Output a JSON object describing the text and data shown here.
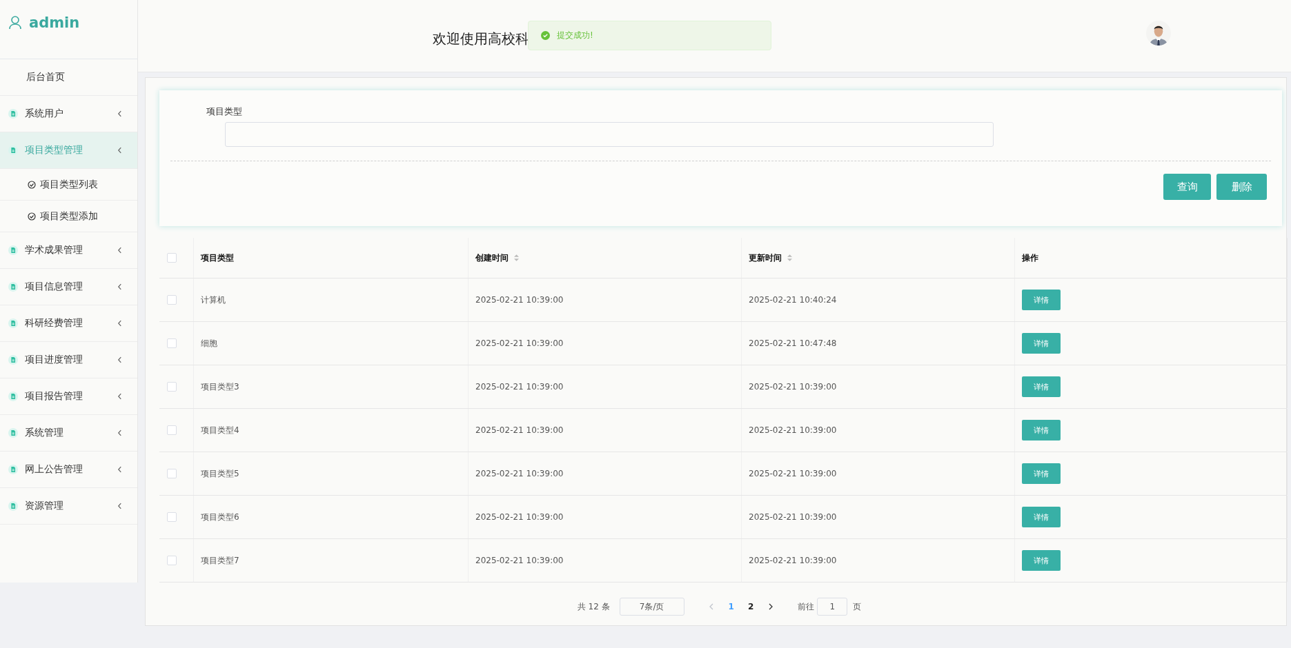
{
  "sidebar": {
    "user": "admin",
    "items": [
      {
        "kind": "home",
        "label": "后台首页"
      },
      {
        "kind": "group",
        "label": "系统用户",
        "selected": false
      },
      {
        "kind": "group",
        "label": "项目类型管理",
        "selected": true,
        "children": [
          {
            "label": "项目类型列表"
          },
          {
            "label": "项目类型添加"
          }
        ]
      },
      {
        "kind": "group",
        "label": "学术成果管理",
        "selected": false
      },
      {
        "kind": "group",
        "label": "项目信息管理",
        "selected": false
      },
      {
        "kind": "group",
        "label": "科研经费管理",
        "selected": false
      },
      {
        "kind": "group",
        "label": "项目进度管理",
        "selected": false
      },
      {
        "kind": "group",
        "label": "项目报告管理",
        "selected": false
      },
      {
        "kind": "group",
        "label": "系统管理",
        "selected": false
      },
      {
        "kind": "group",
        "label": "网上公告管理",
        "selected": false
      },
      {
        "kind": "group",
        "label": "资源管理",
        "selected": false
      }
    ]
  },
  "header": {
    "title": "欢迎使用高校科"
  },
  "toast": {
    "text": "提交成功!"
  },
  "search": {
    "label": "项目类型",
    "buttons": [
      "查询",
      "删除"
    ]
  },
  "table": {
    "all_checked": false,
    "columns": [
      {
        "label": "项目类型",
        "sortable": false
      },
      {
        "label": "创建时间",
        "sortable": true
      },
      {
        "label": "更新时间",
        "sortable": true
      },
      {
        "label": "操作",
        "sortable": false
      }
    ],
    "rows": [
      {
        "checked": false,
        "cells": [
          "计算机",
          "2025-02-21 10:39:00",
          "2025-02-21 10:40:24"
        ],
        "action": "详情"
      },
      {
        "checked": false,
        "cells": [
          "细胞",
          "2025-02-21 10:39:00",
          "2025-02-21 10:47:48"
        ],
        "action": "详情"
      },
      {
        "checked": false,
        "cells": [
          "项目类型3",
          "2025-02-21 10:39:00",
          "2025-02-21 10:39:00"
        ],
        "action": "详情"
      },
      {
        "checked": false,
        "cells": [
          "项目类型4",
          "2025-02-21 10:39:00",
          "2025-02-21 10:39:00"
        ],
        "action": "详情"
      },
      {
        "checked": false,
        "cells": [
          "项目类型5",
          "2025-02-21 10:39:00",
          "2025-02-21 10:39:00"
        ],
        "action": "详情"
      },
      {
        "checked": false,
        "cells": [
          "项目类型6",
          "2025-02-21 10:39:00",
          "2025-02-21 10:39:00"
        ],
        "action": "详情"
      },
      {
        "checked": false,
        "cells": [
          "项目类型7",
          "2025-02-21 10:39:00",
          "2025-02-21 10:39:00"
        ],
        "action": "详情"
      }
    ]
  },
  "pagination": {
    "total": "共 12 条",
    "page_size": "7条/页",
    "pages": [
      {
        "label": "1",
        "selected": true
      },
      {
        "label": "2",
        "selected": false
      }
    ],
    "goto_label": "前往",
    "goto_value": "1",
    "goto_suffix": "页"
  }
}
